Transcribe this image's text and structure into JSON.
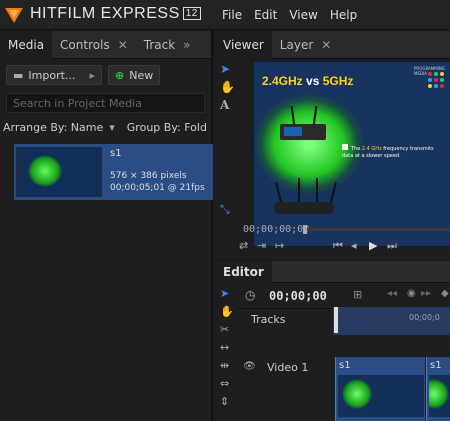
{
  "app": {
    "brand_name": "HITFILM EXPRESS",
    "version_badge": "12",
    "menu": [
      "File",
      "Edit",
      "View",
      "Help"
    ]
  },
  "media_panel": {
    "tabs": [
      {
        "label": "Media"
      },
      {
        "label": "Controls"
      },
      {
        "label": "Track"
      }
    ],
    "overflow_symbol": "»",
    "import_label": "Import...",
    "new_label": "New",
    "search_placeholder": "Search in Project Media",
    "arrange_label": "Arrange By: Name",
    "group_label": "Group By: Fold",
    "item": {
      "name": "s1",
      "dimensions": "576 × 386 pixels",
      "duration": "00;00;05;01 @ 21fps"
    }
  },
  "viewer": {
    "tabs": [
      {
        "label": "Viewer"
      },
      {
        "label": "Layer"
      }
    ],
    "slide": {
      "title_part1": "2.4GHz",
      "title_vs": " vs ",
      "title_part2": "5GHz",
      "bullet_text_a": "The ",
      "bullet_highlight": "2.4 GHz",
      "bullet_text_b": " frequency transmits data at a slower speed.",
      "brand_tag": "PROGRAMMING MEDIA"
    },
    "timecode": "00;00;00;00"
  },
  "editor": {
    "tab_label": "Editor",
    "timecode": "00;00;00",
    "tracks_label": "Tracks",
    "ruler_tick": "00;00;0",
    "video_track_label": "Video 1",
    "clips": [
      {
        "name": "s1"
      },
      {
        "name": "s1"
      }
    ]
  }
}
